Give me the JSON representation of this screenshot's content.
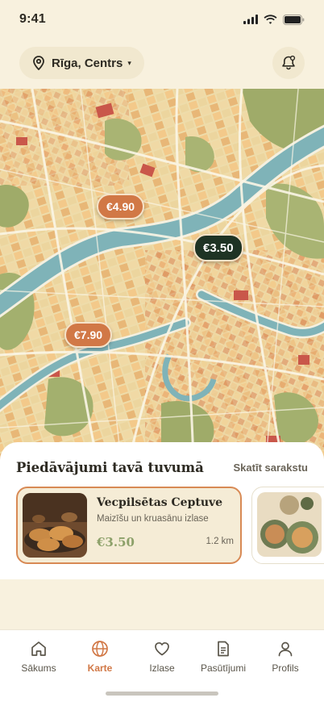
{
  "status": {
    "time": "9:41"
  },
  "header": {
    "location": "Rīga, Centrs"
  },
  "map": {
    "pins": [
      {
        "label": "€4.90",
        "style": "orange"
      },
      {
        "label": "€3.50",
        "style": "dark"
      },
      {
        "label": "€7.90",
        "style": "orange"
      }
    ]
  },
  "nearby": {
    "title": "Piedāvājumi tavā tuvumā",
    "link": "Skatīt sarakstu",
    "offers": [
      {
        "name": "Vecpilsētas Ceptuve",
        "desc": "Maizīšu un kruasānu izlase",
        "price": "€3.50",
        "distance": "1.2 km"
      }
    ]
  },
  "tabs": [
    {
      "label": "Sākums",
      "icon": "home-icon"
    },
    {
      "label": "Karte",
      "icon": "globe-icon",
      "active": true
    },
    {
      "label": "Izlase",
      "icon": "heart-icon"
    },
    {
      "label": "Pasūtījumi",
      "icon": "receipt-icon"
    },
    {
      "label": "Profils",
      "icon": "user-icon"
    }
  ],
  "colors": {
    "accent": "#d17846",
    "dark_pin": "#1e3324",
    "price_green": "#8da16a",
    "background": "#f8f1de"
  }
}
